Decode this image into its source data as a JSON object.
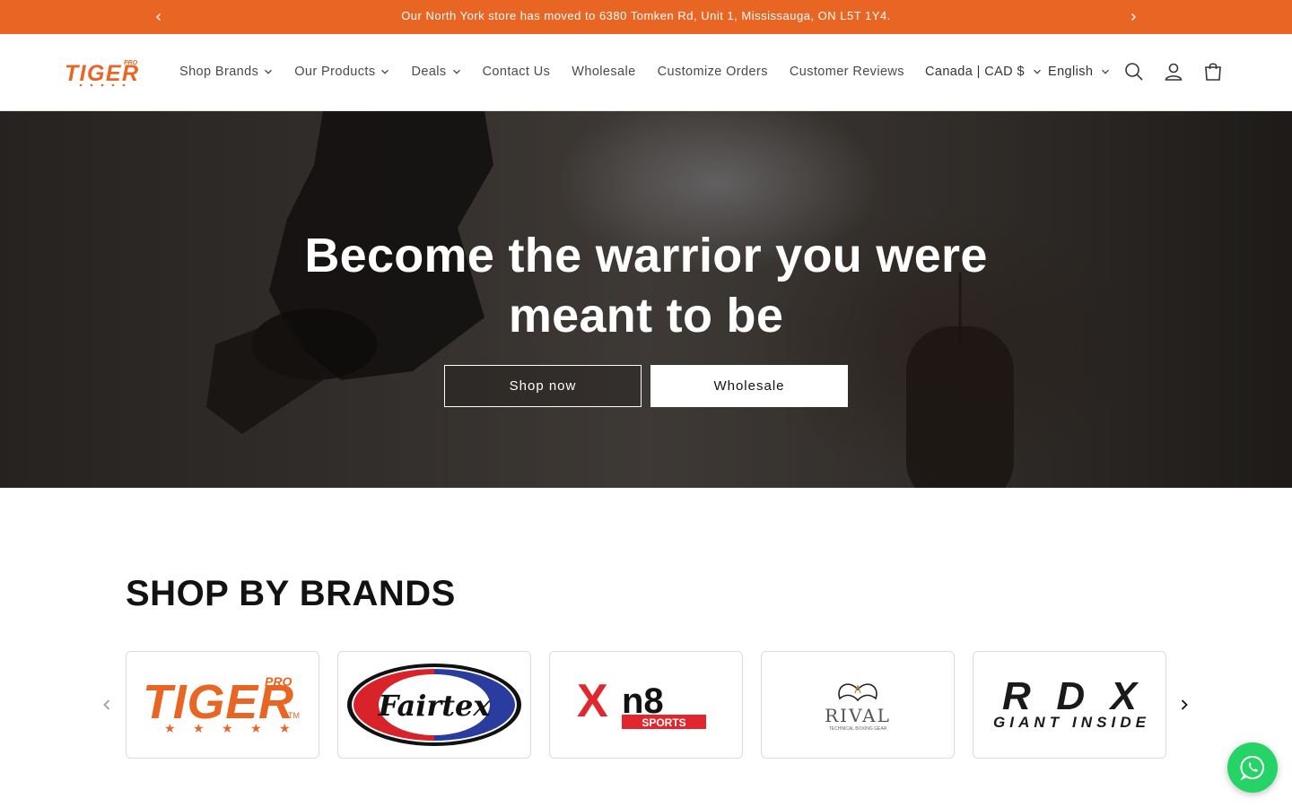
{
  "announcement": {
    "message": "Our North York store has moved to 6380 Tomken Rd, Unit 1, Mississauga, ON L5T 1Y4.",
    "prev_icon": "chevron-left-icon",
    "next_icon": "chevron-right-icon"
  },
  "header": {
    "logo_text": "TIGER",
    "logo_sup": "PRO",
    "nav": [
      {
        "label": "Shop Brands",
        "dropdown": true
      },
      {
        "label": "Our Products",
        "dropdown": true
      },
      {
        "label": "Deals",
        "dropdown": true
      },
      {
        "label": "Contact Us",
        "dropdown": false
      },
      {
        "label": "Wholesale",
        "dropdown": false
      },
      {
        "label": "Customize Orders",
        "dropdown": false
      },
      {
        "label": "Customer Reviews",
        "dropdown": false
      }
    ],
    "country": "Canada | CAD $",
    "language": "English",
    "icons": [
      "search-icon",
      "account-icon",
      "cart-icon"
    ]
  },
  "hero": {
    "heading": "Become the warrior you were meant to be",
    "primary_button": "Shop now",
    "secondary_button": "Wholesale"
  },
  "brands": {
    "title": "SHOP BY BRANDS",
    "items": [
      {
        "name": "TIGER",
        "sup": "PRO",
        "tm": "TM"
      },
      {
        "name": "Fairtex"
      },
      {
        "name": "Xn8",
        "sub": "SPORTS"
      },
      {
        "name": "RIVAL",
        "sub": "TECHNICAL BOXING GEAR"
      },
      {
        "name": "RDX",
        "sub": "GIANT INSIDE"
      }
    ]
  },
  "colors": {
    "accent": "#e96524",
    "text": "#121212",
    "chat": "#25d366"
  }
}
